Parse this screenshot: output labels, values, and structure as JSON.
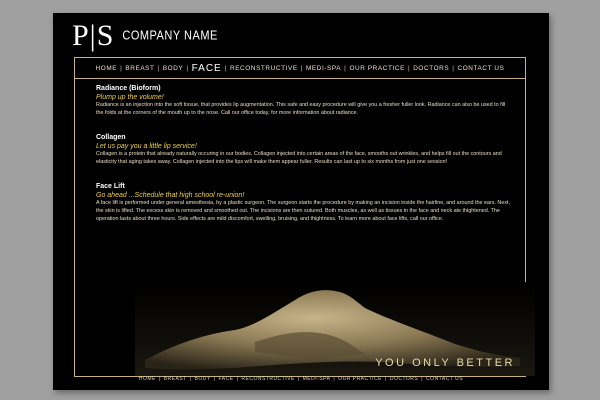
{
  "logo": {
    "mark": "P|S",
    "name": "COMPANY NAME"
  },
  "nav": {
    "items": [
      {
        "label": "HOME",
        "active": false
      },
      {
        "label": "BREAST",
        "active": false
      },
      {
        "label": "BODY",
        "active": false
      },
      {
        "label": "FACE",
        "active": true
      },
      {
        "label": "RECONSTRUCTIVE",
        "active": false
      },
      {
        "label": "MEDI-SPA",
        "active": false
      },
      {
        "label": "OUR PRACTICE",
        "active": false
      },
      {
        "label": "DOCTORS",
        "active": false
      },
      {
        "label": "CONTACT US",
        "active": false
      }
    ],
    "separator": "|"
  },
  "sections": [
    {
      "title": "Radiance (Bioform)",
      "subtitle": "Plump up the volume!",
      "body": "Radiance is an injection into the soft tissue, that provides lip augmentation. This safe and easy procedure will give you a fresher fuller look. Radiance can also be used to fill the folds at the corners of the mouth up to the nose. Call our office today, for more information about radiance."
    },
    {
      "title": "Collagen",
      "subtitle": "Let us  pay you a little lip service!",
      "body": "Collagen is a protein that already naturally occuring in our bodies. Collagen injected into certain areas of the face, smooths out wrinkles, and helps fill out the contours and elasticity that aging takes away. Collagen injected into the lips will make them appear fuller. Results can last up to six months from just one session!"
    },
    {
      "title": "Face Lift",
      "subtitle": "Go ahead ...Schedule that high school re-union!",
      "body": "A face lift is performed under general amesthesia, by a plastic surgeon. The surgeon starts the procedure by making an incision inside the hairline, and around the ears. Next, the skin is lifted. The excess skin is removed and smoothed out. The incisions are then sutured. Both muscles, as well as tissues in the face and neck ate thightened. The operation lasts about three hours. Side effects are mild discomfort, swelling, bruising, and thightness. To learn more about face lifts, call our office."
    }
  ],
  "tagline": "YOU ONLY BETTER",
  "footer_nav": [
    "HOME",
    "BREAST",
    "BODY",
    "FACE",
    "RECONSTRUCTIVE",
    "MEDI-SPA",
    "OUR PRACTICE",
    "DOCTORS",
    "CONTACT US"
  ],
  "colors": {
    "background": "#a0a0a0",
    "page": "#000000",
    "accent_border": "#c9b37a",
    "subtitle": "#f0d048",
    "body_text": "#e8dcc0"
  }
}
